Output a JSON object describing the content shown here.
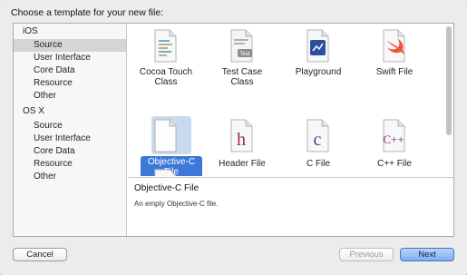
{
  "heading": "Choose a template for your new file:",
  "sidebar": {
    "sections": [
      {
        "header": "iOS",
        "items": [
          "Source",
          "User Interface",
          "Core Data",
          "Resource",
          "Other"
        ],
        "selected": "Source"
      },
      {
        "header": "OS X",
        "items": [
          "Source",
          "User Interface",
          "Core Data",
          "Resource",
          "Other"
        ]
      }
    ]
  },
  "templates": [
    {
      "label": "Cocoa Touch Class",
      "icon": "cocoa-touch-class-icon"
    },
    {
      "label": "Test Case Class",
      "icon": "test-case-class-icon",
      "badge": "Test"
    },
    {
      "label": "Playground",
      "icon": "playground-icon"
    },
    {
      "label": "Swift File",
      "icon": "swift-file-icon"
    },
    {
      "label": "Objective-C File",
      "icon": "objective-c-file-icon",
      "selected": true
    },
    {
      "label": "Header File",
      "icon": "header-file-icon",
      "glyph": "h"
    },
    {
      "label": "C File",
      "icon": "c-file-icon",
      "glyph": "c"
    },
    {
      "label": "C++ File",
      "icon": "cpp-file-icon",
      "glyph": "C++"
    }
  ],
  "detail": {
    "title": "Objective-C File",
    "description": "An empty Objective-C file."
  },
  "buttons": {
    "cancel": "Cancel",
    "previous": "Previous",
    "next": "Next"
  },
  "colors": {
    "selection": "#3d78d8",
    "header_glyph": "#9b2d3a",
    "c_glyph": "#5b3a8e",
    "cpp_glyph": "#8a2a6e",
    "swift": "#f05138",
    "playground": "#2b4f9e"
  }
}
